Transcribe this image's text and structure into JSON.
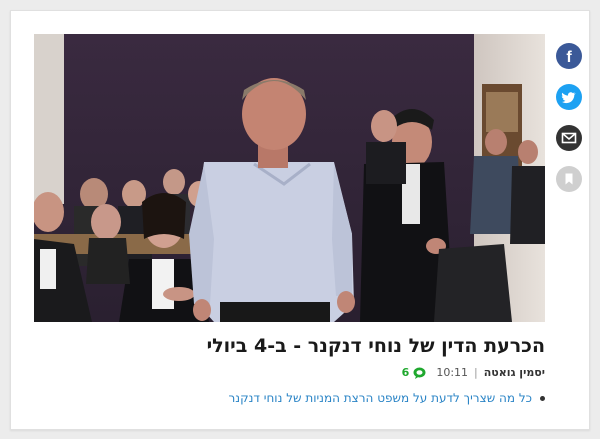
{
  "article": {
    "headline": "הכרעת הדין של נוחי דנקנר - ב-4 ביולי",
    "author": "יסמין גואטה",
    "time": "10:11",
    "comments_count": "6",
    "related_link": "כל מה שצריך לדעת על משפט הרצת המניות של נוחי דנקנר",
    "photo_icon": "courtroom-photo"
  },
  "share": {
    "facebook_icon": "facebook-icon",
    "twitter_icon": "twitter-icon",
    "email_icon": "email-icon",
    "bookmark_icon": "bookmark-icon"
  },
  "colors": {
    "facebook": "#3b5998",
    "twitter": "#1da1f2",
    "email": "#333333",
    "bookmark": "#cfcfcf",
    "comments": "#1fa82e",
    "link": "#2a84c6"
  }
}
